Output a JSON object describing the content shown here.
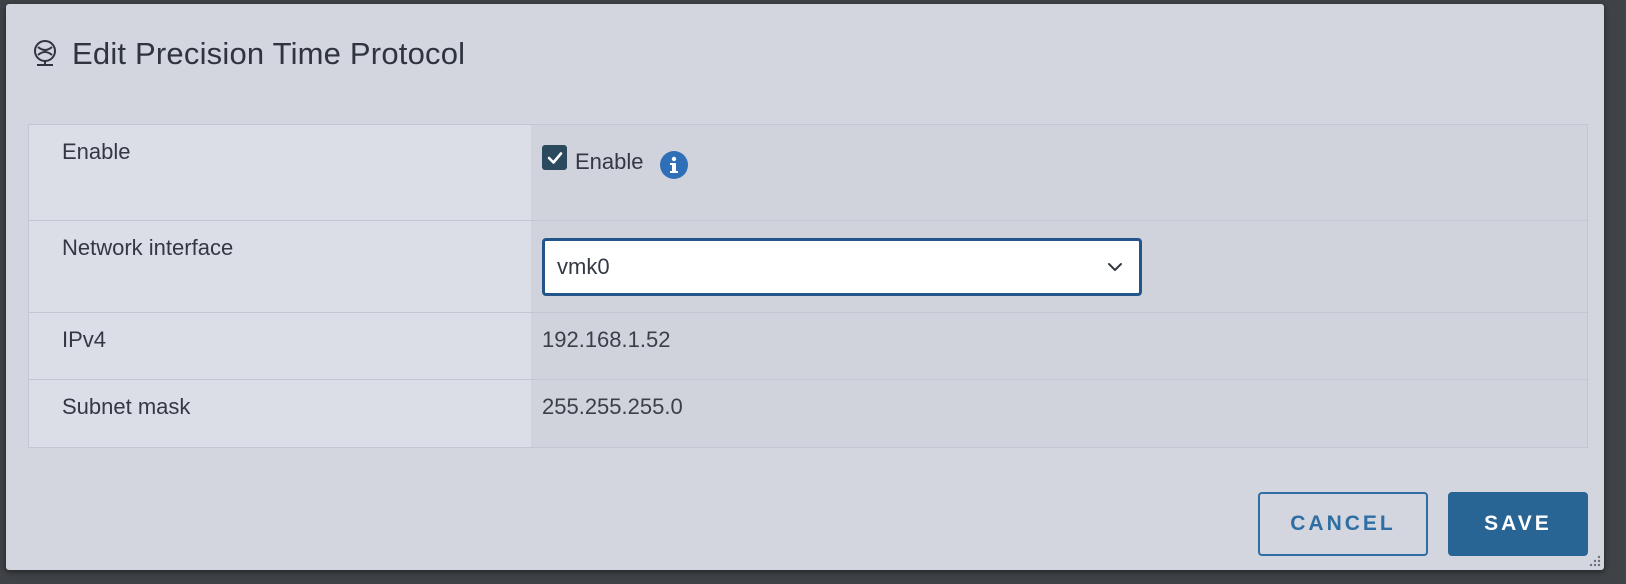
{
  "dialog": {
    "title": "Edit Precision Time Protocol",
    "icon": "ptp-clock-icon"
  },
  "form": {
    "enable": {
      "label": "Enable",
      "checkbox_label": "Enable",
      "checked": true
    },
    "network_interface": {
      "label": "Network interface",
      "selected": "vmk0"
    },
    "ipv4": {
      "label": "IPv4",
      "value": "192.168.1.52"
    },
    "subnet_mask": {
      "label": "Subnet mask",
      "value": "255.255.255.0"
    }
  },
  "buttons": {
    "cancel": "CANCEL",
    "save": "SAVE"
  },
  "colors": {
    "primary": "#286494",
    "focus_border": "#23558a",
    "info": "#2f6fb7",
    "dialog_bg": "#d3d5df"
  }
}
